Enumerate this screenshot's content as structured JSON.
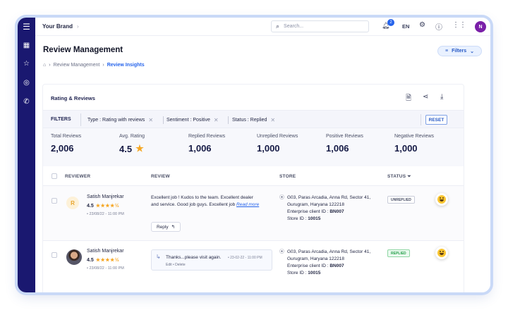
{
  "topbar": {
    "brand": "Your Brand",
    "search_placeholder": "Search...",
    "notification_count": "2",
    "language": "EN",
    "avatar_initial": "N"
  },
  "page": {
    "title": "Review Management",
    "breadcrumb": [
      "Review Management",
      "Review Insights"
    ],
    "filters_button": "Filters"
  },
  "card": {
    "title": "Rating & Reviews",
    "filters_label": "FILTERS",
    "chips": [
      "Type : Rating with reviews",
      "Sentiment : Positive",
      "Status : Replied"
    ],
    "reset_label": "RESET"
  },
  "stats": [
    {
      "label": "Total Reviews",
      "value": "2,006"
    },
    {
      "label": "Avg. Rating",
      "value": "4.5"
    },
    {
      "label": "Replied Reviews",
      "value": "1,006"
    },
    {
      "label": "Unreplied Reviews",
      "value": "1,000"
    },
    {
      "label": "Positive Reviews",
      "value": "1,006"
    },
    {
      "label": "Negative Reviews",
      "value": "1,000"
    }
  ],
  "table": {
    "headers": {
      "reviewer": "REVIEWER",
      "review": "REVIEW",
      "store": "STORE",
      "status": "STATUS"
    },
    "rows": [
      {
        "avatar_letter": "R",
        "name": "Satish Manjrekar",
        "rating": "4.5",
        "date": "• 23/08/22 - 11:00 PM",
        "review": "Excellent job ! Kudos to the team. Excellent dealer and service. Good job guys. Excellent job",
        "read_more": "Read more",
        "reply_label": "Reply",
        "store_line1": "G03, Paras Arcadia, Anna Rd, Sector 41,",
        "store_line2": "Gurugram, Haryana 122218",
        "enterprise_label": "Enterprise client ID :",
        "enterprise_id": "BN007",
        "store_id_label": "Store ID :",
        "store_id": "10015",
        "status": "UNREPLIED"
      },
      {
        "name": "Satish Manjrekar",
        "rating": "4.5",
        "date": "• 23/08/22 - 11:00 PM",
        "reply_text": "Thanks...please visit again.",
        "reply_date": "• 23-02-22 - 11:00 PM",
        "reply_actions": "Edit • Delete",
        "store_line1": "G03, Paras Arcadia, Anna Rd, Sector 41,",
        "store_line2": "Gurugram, Haryana 122218",
        "enterprise_label": "Enterprise client ID :",
        "enterprise_id": "BN007",
        "store_id_label": "Store ID :",
        "store_id": "10015",
        "status": "REPLIED"
      }
    ]
  },
  "colors": {
    "sidebar": "#1a1870",
    "accent": "#2563eb",
    "star": "#f5a623"
  }
}
